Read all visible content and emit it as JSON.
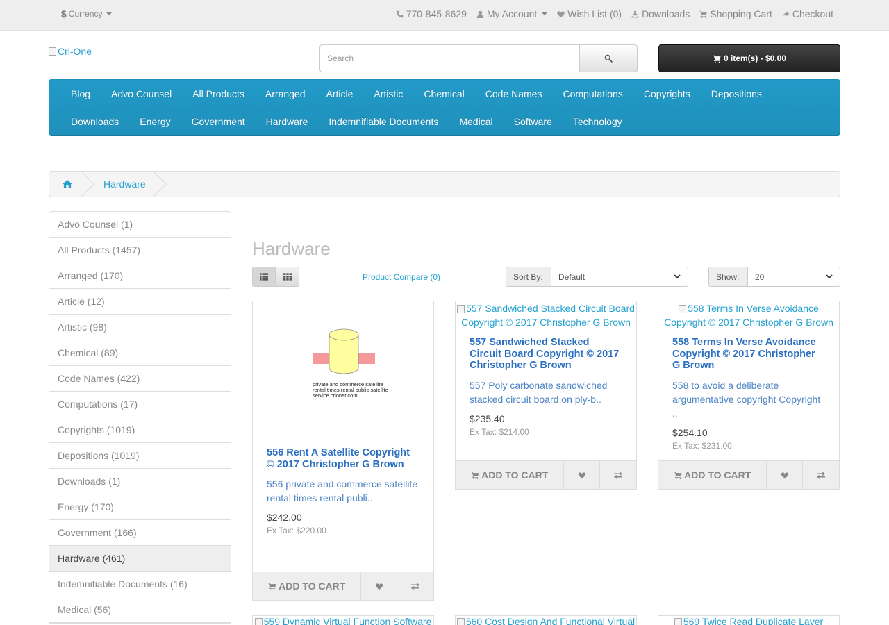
{
  "topbar": {
    "currency": {
      "symbol": "$",
      "label": "Currency"
    },
    "phone": "770-845-8629",
    "my_account": "My Account",
    "wish_list": "Wish List (0)",
    "downloads": "Downloads",
    "shopping_cart": "Shopping Cart",
    "checkout": "Checkout"
  },
  "header": {
    "logo_alt": "Cri-One",
    "search_placeholder": "Search",
    "cart_label": "0 item(s) - $0.00"
  },
  "menu": {
    "row1": [
      "Blog",
      "Advo Counsel",
      "All Products",
      "Arranged",
      "Article",
      "Artistic",
      "Chemical",
      "Code Names",
      "Computations",
      "Copyrights",
      "Depositions"
    ],
    "row2": [
      "Downloads",
      "Energy",
      "Government",
      "Hardware",
      "Indemnifiable Documents",
      "Medical",
      "Software",
      "Technology"
    ]
  },
  "breadcrumb": {
    "current": "Hardware"
  },
  "sidebar": {
    "items": [
      {
        "label": "Advo Counsel (1)"
      },
      {
        "label": "All Products (1457)"
      },
      {
        "label": "Arranged (170)"
      },
      {
        "label": "Article (12)"
      },
      {
        "label": "Artistic (98)"
      },
      {
        "label": "Chemical (89)"
      },
      {
        "label": "Code Names (422)"
      },
      {
        "label": "Computations (17)"
      },
      {
        "label": "Copyrights (1019)"
      },
      {
        "label": "Depositions (1019)"
      },
      {
        "label": "Downloads (1)"
      },
      {
        "label": "Energy (170)"
      },
      {
        "label": "Government (166)"
      },
      {
        "label": "Hardware (461)"
      },
      {
        "label": "Indemnifiable Documents (16)"
      },
      {
        "label": "Medical (56)"
      }
    ],
    "active_index": 13
  },
  "content": {
    "title": "Hardware",
    "product_compare": "Product Compare (0)",
    "sort_label": "Sort By:",
    "sort_value": "Default",
    "show_label": "Show:",
    "show_value": "20"
  },
  "products": [
    {
      "image_text": [
        "private and commerce satellite",
        "rental times rental public satellite",
        "service crioner.com"
      ],
      "name": "556 Rent A Satellite Copyright © 2017 Christopher G Brown",
      "desc": "556 private and commerce satellite rental times rental publi..",
      "price": "$242.00",
      "extax": "Ex Tax: $220.00"
    },
    {
      "image_alt": "557 Sandwiched Stacked Circuit Board Copyright © 2017 Christopher G Brown",
      "name": "557 Sandwiched Stacked Circuit Board Copyright © 2017 Christopher G Brown",
      "desc": "557 Poly carbonate sandwiched stacked circuit board on ply-b..",
      "price": "$235.40",
      "extax": "Ex Tax: $214.00"
    },
    {
      "image_alt": "558 Terms In Verse Avoidance Copyright © 2017 Christopher G Brown",
      "name": "558 Terms In Verse Avoidance Copyright © 2017 Christopher G Brown",
      "desc": "558 to avoid a deliberate argumentative copyright Copyright ..",
      "price": "$254.10",
      "extax": "Ex Tax: $231.00"
    }
  ],
  "add_to_cart": "ADD TO CART",
  "next_row_alts": [
    "559 Dynamic Virtual Function Software",
    "560 Cost Design And Functional Virtual",
    "569 Twice Read Duplicate Layer"
  ],
  "colors": {
    "menu_blue": "#229ac8",
    "link_blue": "#23a1d1",
    "cart_dark": "#333333"
  }
}
